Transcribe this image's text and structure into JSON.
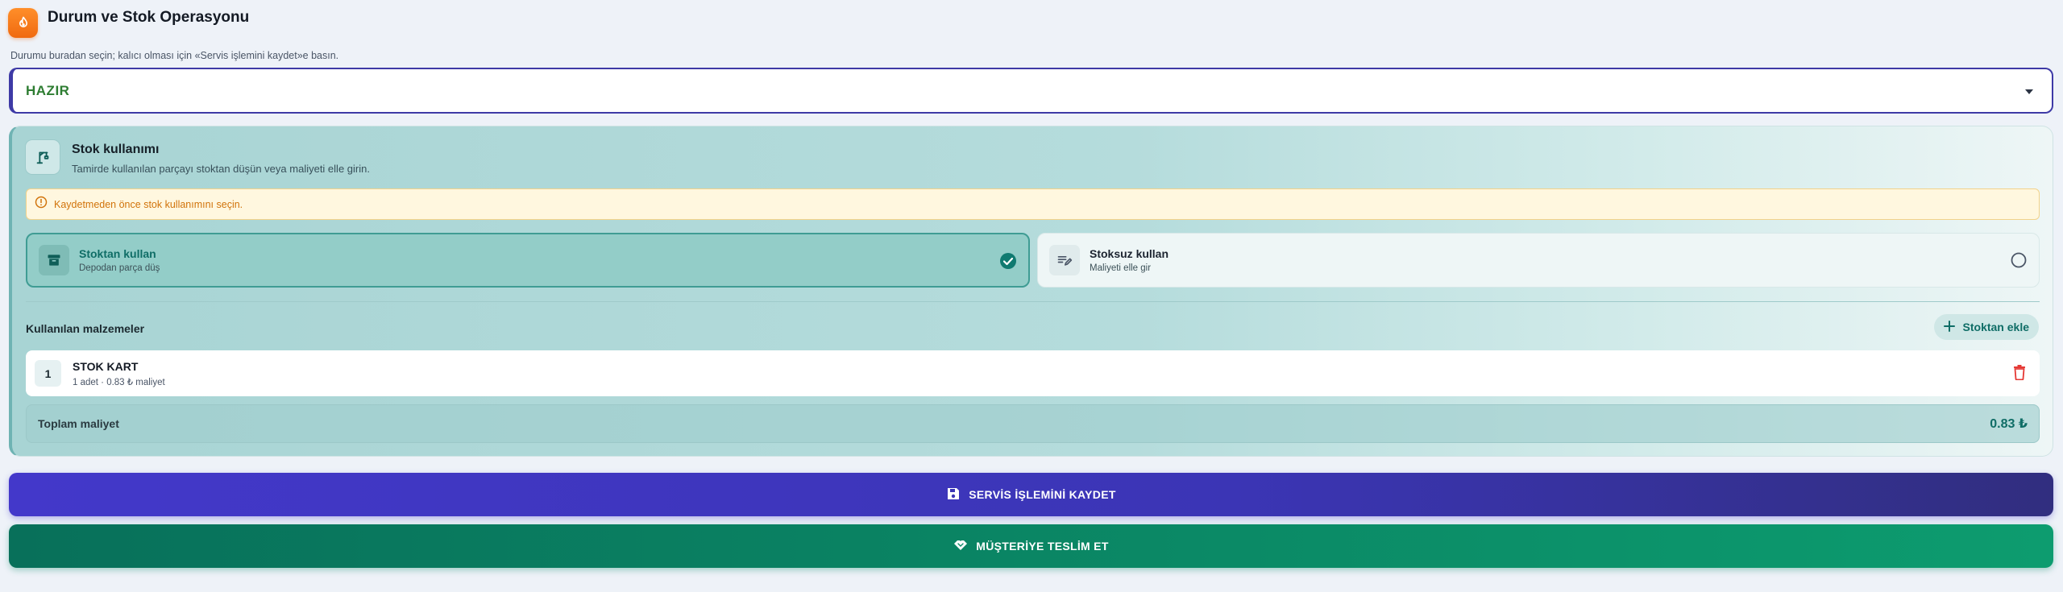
{
  "header": {
    "title": "Durum ve Stok Operasyonu"
  },
  "hint": "Durumu buradan seçin; kalıcı olması için «Servis işlemini kaydet»e basın.",
  "status": {
    "value": "HAZIR"
  },
  "stock": {
    "title": "Stok kullanımı",
    "subtitle": "Tamirde kullanılan parçayı stoktan düşün veya maliyeti elle girin.",
    "warning": "Kaydetmeden önce stok kullanımını seçin.",
    "options": [
      {
        "title": "Stoktan kullan",
        "subtitle": "Depodan parça düş",
        "selected": true
      },
      {
        "title": "Stoksuz kullan",
        "subtitle": "Maliyeti elle gir",
        "selected": false
      }
    ],
    "materials_label": "Kullanılan malzemeler",
    "add_label": "Stoktan ekle",
    "items": [
      {
        "index": "1",
        "name": "STOK KART",
        "meta": "1 adet · 0.83 ₺ maliyet"
      }
    ],
    "total_label": "Toplam maliyet",
    "total_value": "0.83 ₺"
  },
  "actions": {
    "save_label": "SERVİS İŞLEMİNİ KAYDET",
    "deliver_label": "MÜŞTERİYE TESLİM ET"
  },
  "colors": {
    "primary": "#4338ca",
    "success": "#0b8a66",
    "teal": "#0f6d66",
    "warning": "#d1730a",
    "danger": "#e53935",
    "status_text": "#2e7d32",
    "app_icon": "#f57c1f"
  }
}
